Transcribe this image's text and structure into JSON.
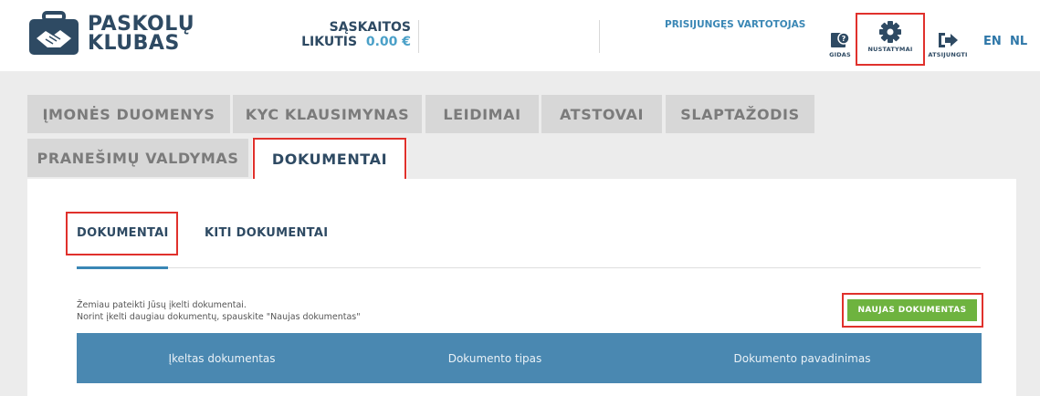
{
  "header": {
    "logo_line1": "PASKOLŲ",
    "logo_line2": "KLUBAS",
    "balance_label_line1": "SĄSKAITOS",
    "balance_label_line2": "LIKUTIS",
    "balance_amount": "0.00 €",
    "user_label": "PRISIJUNGĘS VARTOTOJAS",
    "buttons": {
      "guide": "GIDAS",
      "settings": "NUSTATYMAI",
      "logout": "ATSIJUNGTI"
    },
    "languages": [
      "EN",
      "NL"
    ]
  },
  "tabs": {
    "row1": [
      "ĮMONĖS DUOMENYS",
      "KYC KLAUSIMYNAS",
      "LEIDIMAI",
      "ATSTOVAI",
      "SLAPTAŽODIS"
    ],
    "row2": [
      "PRANEŠIMŲ VALDYMAS",
      "DOKUMENTAI"
    ],
    "active": "DOKUMENTAI"
  },
  "panel": {
    "subtabs": [
      "DOKUMENTAI",
      "KITI DOKUMENTAI"
    ],
    "active_subtab": "DOKUMENTAI",
    "info_line1": "Žemiau pateikti Jūsų įkelti dokumentai.",
    "info_line2": "Norint įkelti daugiau dokumentų, spauskite \"Naujas dokumentas\"",
    "new_document_button": "NAUJAS DOKUMENTAS",
    "table": {
      "columns": [
        "Įkeltas dokumentas",
        "Dokumento tipas",
        "Dokumento pavadinimas"
      ]
    }
  },
  "colors": {
    "brand_dark": "#2e4a63",
    "accent_blue": "#3a87b5",
    "table_header": "#4a88b1",
    "button_green": "#6eb33f",
    "highlight_red": "#e0312c"
  }
}
